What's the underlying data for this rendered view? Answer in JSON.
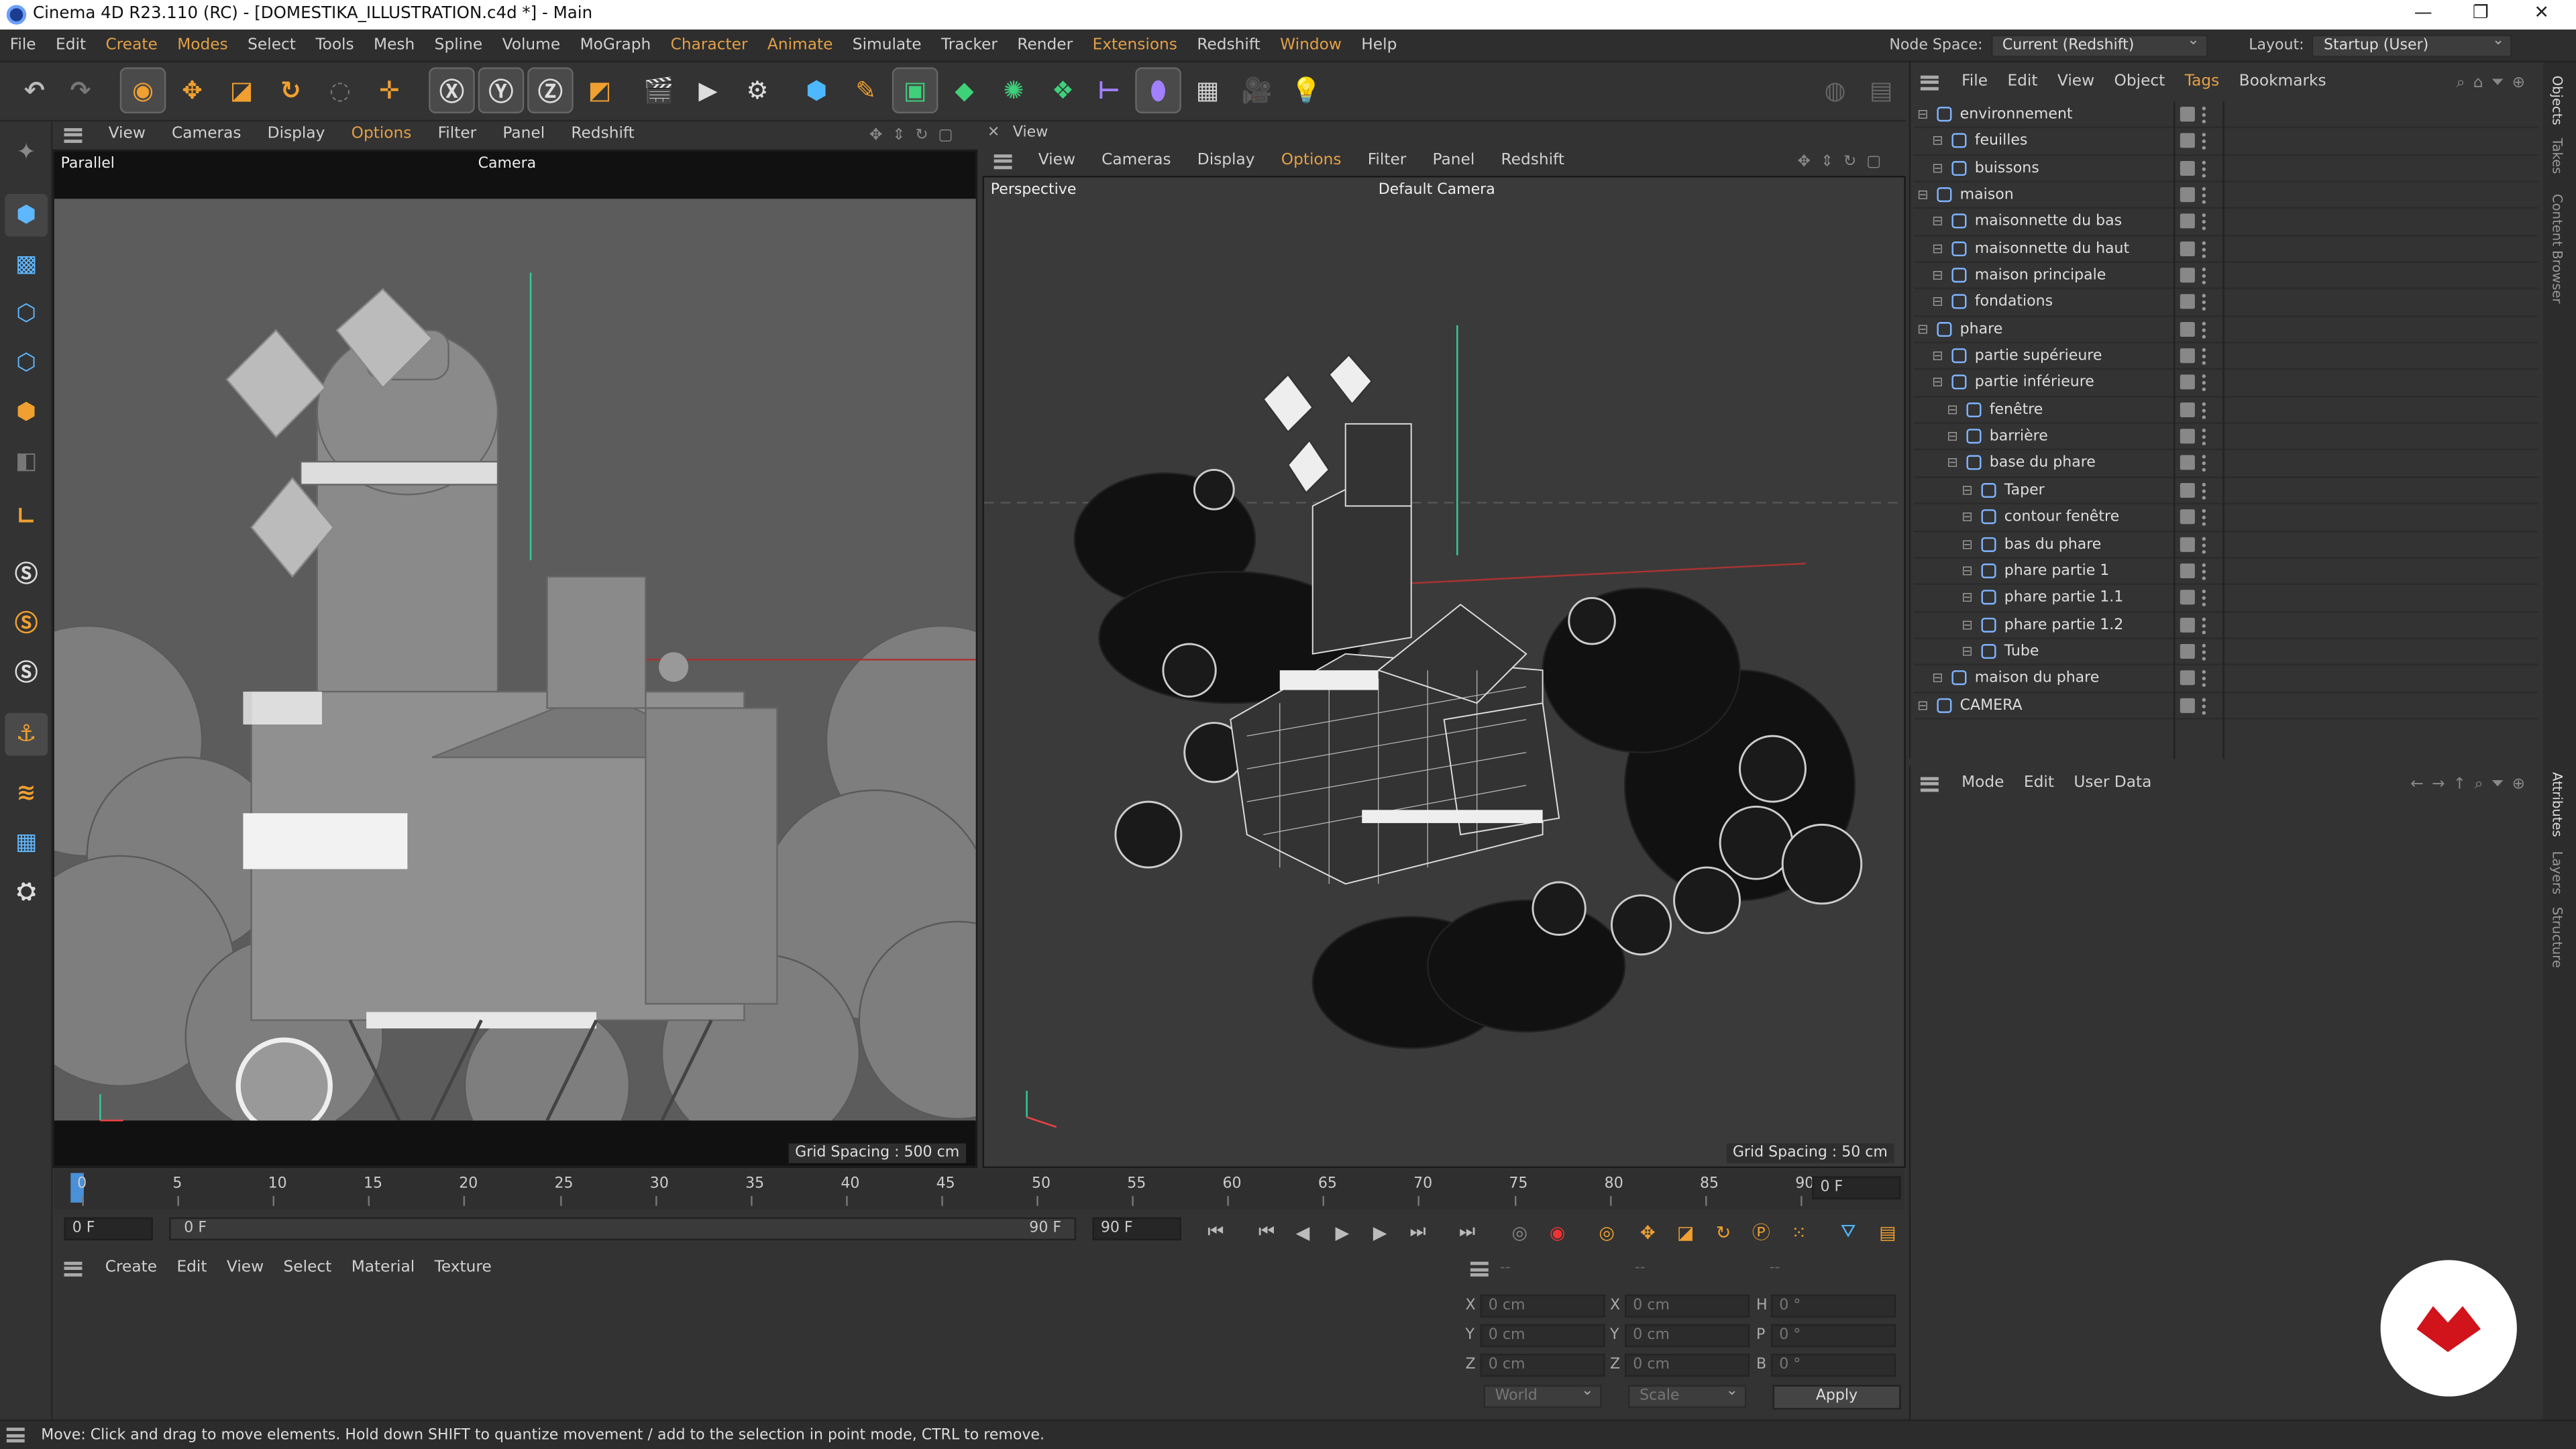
{
  "titlebar": {
    "title": "Cinema 4D R23.110 (RC) - [DOMESTIKA_ILLUSTRATION.c4d *] - Main"
  },
  "menu": {
    "items": [
      "File",
      "Edit",
      "Create",
      "Modes",
      "Select",
      "Tools",
      "Mesh",
      "Spline",
      "Volume",
      "MoGraph",
      "Character",
      "Animate",
      "Simulate",
      "Tracker",
      "Render",
      "Extensions",
      "Redshift",
      "Window",
      "Help"
    ],
    "nodespace_label": "Node Space:",
    "nodespace_value": "Current (Redshift)",
    "layout_label": "Layout:",
    "layout_value": "Startup (User)"
  },
  "viewport1": {
    "menu": [
      "View",
      "Cameras",
      "Display",
      "Options",
      "Filter",
      "Panel",
      "Redshift"
    ],
    "projection": "Parallel",
    "camera": "Camera",
    "grid": "Grid Spacing : 500 cm"
  },
  "viewport2": {
    "title": "View",
    "menu": [
      "View",
      "Cameras",
      "Display",
      "Options",
      "Filter",
      "Panel",
      "Redshift"
    ],
    "projection": "Perspective",
    "camera": "Default Camera",
    "grid": "Grid Spacing : 50 cm"
  },
  "timeline": {
    "ticks": [
      "0",
      "5",
      "10",
      "15",
      "20",
      "25",
      "30",
      "35",
      "40",
      "45",
      "50",
      "55",
      "60",
      "65",
      "70",
      "75",
      "80",
      "85",
      "90"
    ],
    "current": "0 F"
  },
  "frames": {
    "start": "0 F",
    "range_start": "0 F",
    "range_end": "90 F",
    "end": "90 F"
  },
  "material": {
    "menu": [
      "Create",
      "Edit",
      "View",
      "Select",
      "Material",
      "Texture"
    ]
  },
  "coords": {
    "headers": [
      "--",
      "--",
      "--"
    ],
    "labels": [
      "X",
      "Y",
      "Z",
      "X",
      "Y",
      "Z",
      "H",
      "P",
      "B"
    ],
    "values": [
      "0 cm",
      "0 cm",
      "0 cm",
      "0 cm",
      "0 cm",
      "0 cm",
      "0 °",
      "0 °",
      "0 °"
    ],
    "mode": "World",
    "size": "Scale",
    "apply": "Apply"
  },
  "objects": {
    "menu": [
      "File",
      "Edit",
      "View",
      "Object",
      "Tags",
      "Bookmarks"
    ],
    "rows": [
      {
        "name": "environnement",
        "depth": 0
      },
      {
        "name": "feuilles",
        "depth": 1
      },
      {
        "name": "buissons",
        "depth": 1
      },
      {
        "name": "maison",
        "depth": 0
      },
      {
        "name": "maisonnette du bas",
        "depth": 1
      },
      {
        "name": "maisonnette du haut",
        "depth": 1
      },
      {
        "name": "maison principale",
        "depth": 1
      },
      {
        "name": "fondations",
        "depth": 1
      },
      {
        "name": "phare",
        "depth": 0
      },
      {
        "name": "partie supérieure",
        "depth": 1
      },
      {
        "name": "partie inférieure",
        "depth": 1
      },
      {
        "name": "fenêtre",
        "depth": 2
      },
      {
        "name": "barrière",
        "depth": 2
      },
      {
        "name": "base du phare",
        "depth": 2
      },
      {
        "name": "Taper",
        "depth": 3
      },
      {
        "name": "contour fenêtre",
        "depth": 3
      },
      {
        "name": "bas du phare",
        "depth": 3
      },
      {
        "name": "phare partie 1",
        "depth": 3
      },
      {
        "name": "phare partie 1.1",
        "depth": 3
      },
      {
        "name": "phare partie 1.2",
        "depth": 3
      },
      {
        "name": "Tube",
        "depth": 3
      },
      {
        "name": "maison du phare",
        "depth": 1
      },
      {
        "name": "CAMERA",
        "depth": 0
      }
    ]
  },
  "attributes": {
    "menu": [
      "Mode",
      "Edit",
      "User Data"
    ]
  },
  "side_tabs": [
    "Objects",
    "Takes",
    "Content Browser",
    "Attributes",
    "Layers",
    "Structure"
  ],
  "status": "Move: Click and drag to move elements. Hold down SHIFT to quantize movement / add to the selection in point mode, CTRL to remove.",
  "colors": {
    "accent": "#e3a047",
    "logo": "#d1131b"
  }
}
